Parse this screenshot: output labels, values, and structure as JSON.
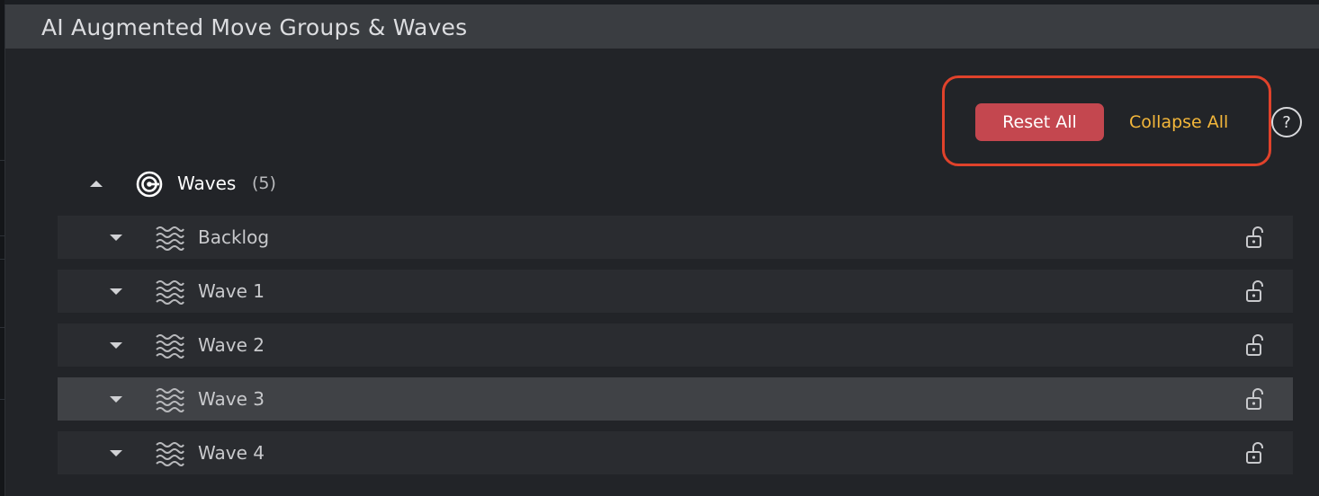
{
  "panel": {
    "title": "AI Augmented Move Groups & Waves"
  },
  "toolbar": {
    "reset_label": "Reset All",
    "collapse_label": "Collapse All",
    "help_label": "?"
  },
  "waves": {
    "label": "Waves",
    "count": "(5)",
    "items": [
      {
        "name": "Backlog",
        "selected": false,
        "lock": "unlock-icon"
      },
      {
        "name": "Wave 1",
        "selected": false,
        "lock": "unlock-icon"
      },
      {
        "name": "Wave 2",
        "selected": false,
        "lock": "unlock-icon"
      },
      {
        "name": "Wave 3",
        "selected": true,
        "lock": "unlock-icon"
      },
      {
        "name": "Wave 4",
        "selected": false,
        "lock": "unlock-icon"
      }
    ]
  },
  "colors": {
    "accent_reset": "#c4474f",
    "accent_collapse": "#f4b73a",
    "highlight_border": "#e0422b"
  }
}
